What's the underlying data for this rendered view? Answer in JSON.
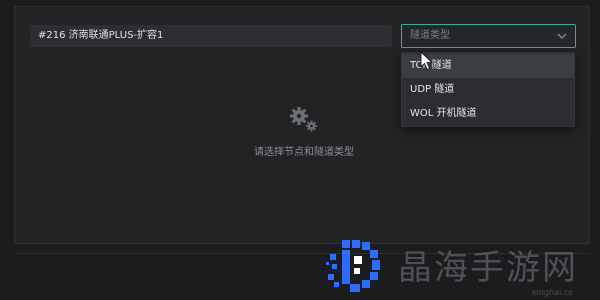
{
  "node": {
    "value": "#216 济南联通PLUS-扩容1"
  },
  "tunnel_type": {
    "placeholder": "隧道类型",
    "options": [
      {
        "label": "TCP 隧道"
      },
      {
        "label": "UDP 隧道"
      },
      {
        "label": "WOL 开机隧道"
      }
    ]
  },
  "empty_state": {
    "text": "请选择节点和隧道类型",
    "icon": "gears-icon"
  },
  "watermark": {
    "brand": "晶海手游网",
    "url": "kinghai.co"
  },
  "colors": {
    "accent": "#3fae86",
    "brand_blue": "#2f6bff",
    "background": "#1b1c1e"
  }
}
